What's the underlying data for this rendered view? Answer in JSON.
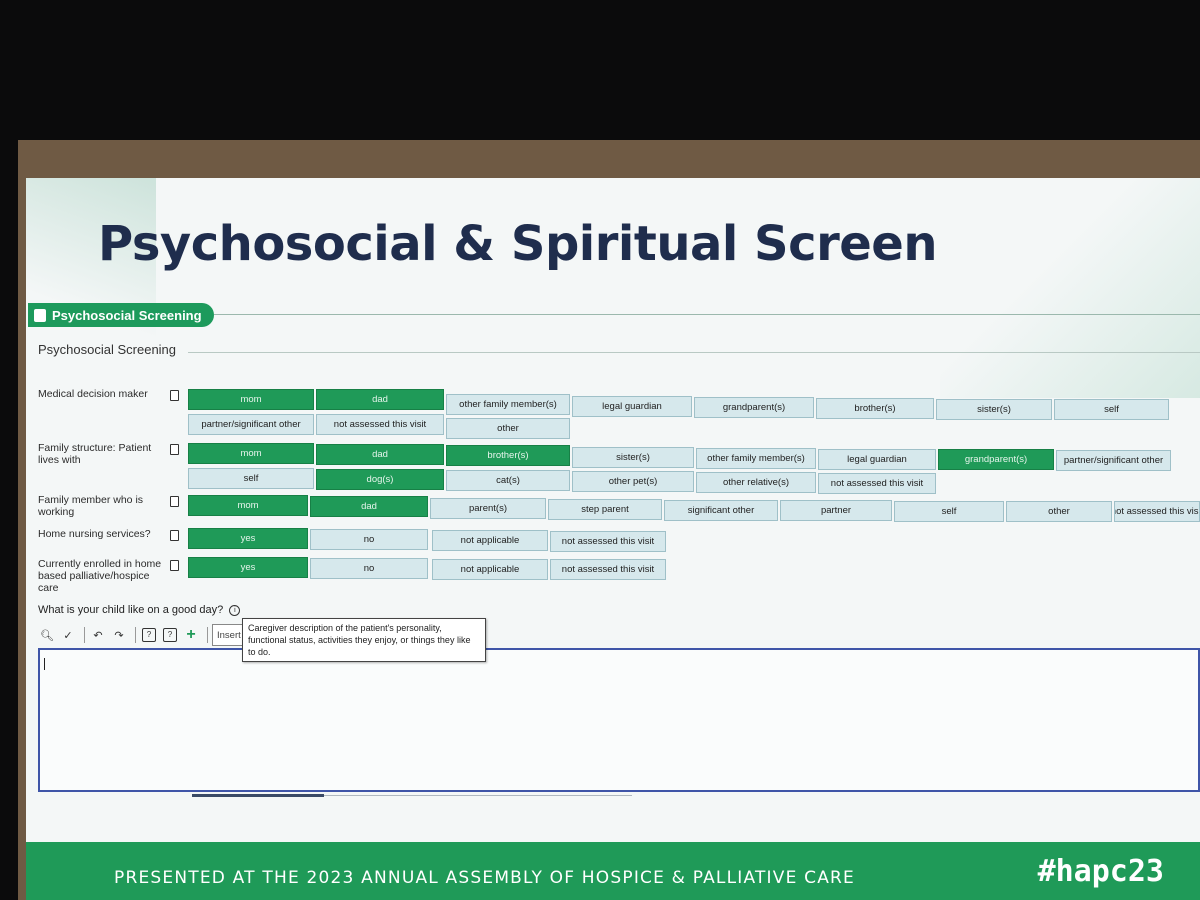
{
  "slide": {
    "title": "Psychosocial & Spiritual Screen",
    "section_tab": "Psychosocial Screening",
    "section_heading": "Psychosocial Screening"
  },
  "fields": {
    "medical_decision_maker": {
      "label": "Medical decision maker",
      "options": [
        "mom",
        "dad",
        "other family member(s)",
        "legal guardian",
        "grandparent(s)",
        "brother(s)",
        "sister(s)",
        "self",
        "partner/significant other",
        "not assessed this visit",
        "other"
      ],
      "selected": [
        "mom",
        "dad"
      ]
    },
    "family_structure": {
      "label": "Family structure: Patient lives with",
      "options": [
        "mom",
        "dad",
        "brother(s)",
        "sister(s)",
        "other family member(s)",
        "legal guardian",
        "grandparent(s)",
        "partner/significant other",
        "self",
        "dog(s)",
        "cat(s)",
        "other pet(s)",
        "other relative(s)",
        "not assessed this visit"
      ],
      "selected": [
        "mom",
        "dad",
        "brother(s)",
        "grandparent(s)",
        "dog(s)"
      ]
    },
    "family_member_working": {
      "label": "Family member who is working",
      "options": [
        "mom",
        "dad",
        "parent(s)",
        "step parent",
        "significant other",
        "partner",
        "self",
        "other",
        "not assessed this visit"
      ],
      "selected": [
        "mom",
        "dad"
      ]
    },
    "home_nursing": {
      "label": "Home nursing services?",
      "options": [
        "yes",
        "no",
        "not applicable",
        "not assessed this visit"
      ],
      "selected": [
        "yes"
      ]
    },
    "home_palliative": {
      "label": "Currently enrolled in home based palliative/hospice care",
      "options": [
        "yes",
        "no",
        "not applicable",
        "not assessed this visit"
      ],
      "selected": [
        "yes"
      ]
    }
  },
  "question": {
    "label": "What is your child like on a good day?",
    "info_glyph": "i",
    "tooltip": "Caregiver description of the patient's personality, functional status, activities they enjoy, or things they like to do.",
    "insert_label": "Insert",
    "value": ""
  },
  "toolbar_icons": [
    "zoom-icon",
    "spellcheck-icon",
    "undo-icon",
    "redo-icon",
    "help-icon",
    "help-alt-icon",
    "add-icon"
  ],
  "footer": {
    "text": "PRESENTED AT THE 2023 ANNUAL ASSEMBLY OF HOSPICE & PALLIATIVE CARE",
    "hashtag": "#hapc23"
  },
  "colors": {
    "selected": "#1f9a58",
    "unselected": "#d6e8ec",
    "title": "#1f2d4d",
    "footer": "#1f9a58"
  }
}
